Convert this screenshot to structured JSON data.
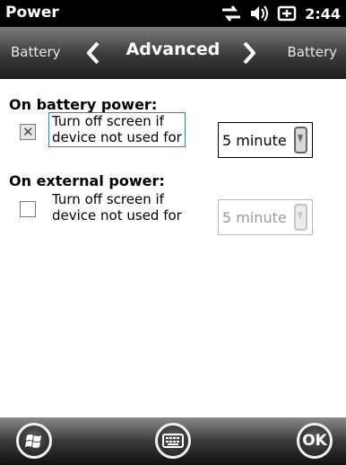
{
  "status_bar": {
    "title": "Power",
    "time": "2:44",
    "icons": [
      "connectivity-arrows-icon",
      "volume-icon",
      "battery-charging-icon"
    ]
  },
  "tabs": {
    "previous": "Battery",
    "current": "Advanced",
    "next": "Battery"
  },
  "battery_section": {
    "heading": "On battery power:",
    "checkbox_checked": true,
    "checkbox_line1": "Turn off screen if",
    "checkbox_line2": "device not used for",
    "timeout_value": "5 minute",
    "enabled": true
  },
  "external_section": {
    "heading": "On external power:",
    "checkbox_checked": false,
    "checkbox_line1": "Turn off screen if",
    "checkbox_line2": "device not used for",
    "timeout_value": "5 minute",
    "enabled": false
  },
  "softkeys": {
    "left_icon": "windows-start-icon",
    "center_icon": "keyboard-icon",
    "right_label": "OK"
  },
  "colors": {
    "focus_border": "#3a7bc8",
    "disabled_text": "#9a9a9a"
  }
}
